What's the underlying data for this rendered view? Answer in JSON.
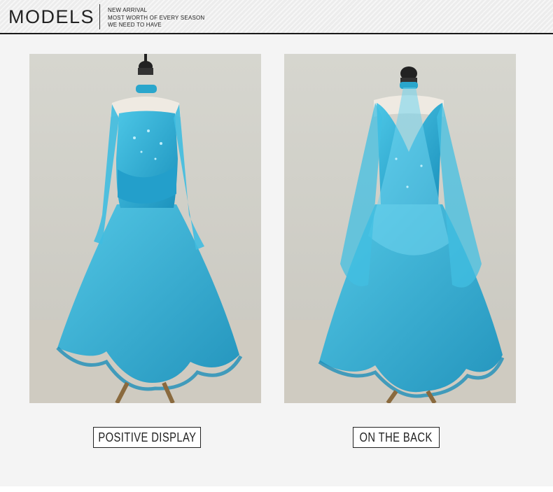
{
  "header": {
    "title": "MODELS",
    "tagline": [
      "NEW ARRIVAL",
      "MOST WORTH OF EVERY SEASON",
      "WE NEED TO HAVE"
    ]
  },
  "photos": [
    {
      "view": "front",
      "icon": "dress-front-photo",
      "caption": "POSITIVE DISPLAY"
    },
    {
      "view": "back",
      "icon": "dress-back-photo",
      "caption": "ON THE BACK"
    }
  ],
  "colors": {
    "dress": "#2fb3d8",
    "dress_dark": "#1b8fb8",
    "backdrop": "#d9d8d2",
    "accent": "#1a1a1a"
  }
}
